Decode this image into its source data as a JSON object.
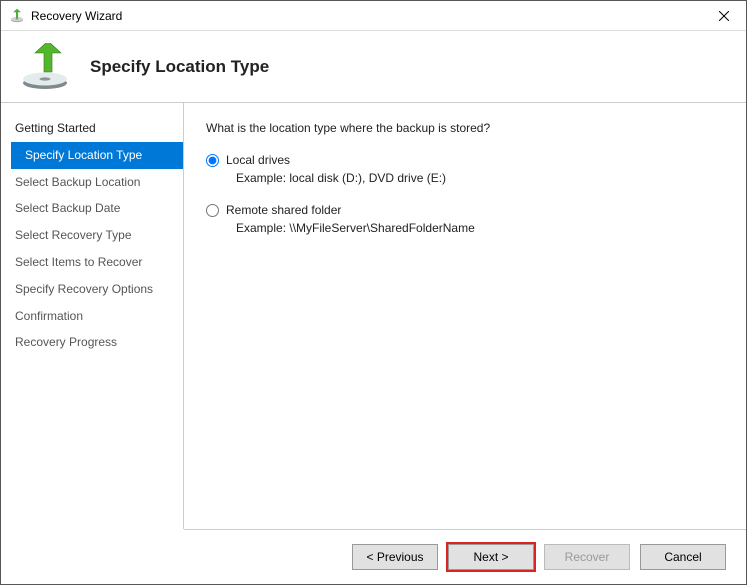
{
  "window": {
    "title": "Recovery Wizard"
  },
  "header": {
    "title": "Specify Location Type"
  },
  "sidebar": {
    "items": [
      {
        "label": "Getting Started"
      },
      {
        "label": "Specify Location Type"
      },
      {
        "label": "Select Backup Location"
      },
      {
        "label": "Select Backup Date"
      },
      {
        "label": "Select Recovery Type"
      },
      {
        "label": "Select Items to Recover"
      },
      {
        "label": "Specify Recovery Options"
      },
      {
        "label": "Confirmation"
      },
      {
        "label": "Recovery Progress"
      }
    ]
  },
  "content": {
    "prompt": "What is the location type where the backup is stored?",
    "options": [
      {
        "label": "Local drives",
        "example": "Example: local disk (D:), DVD drive (E:)",
        "checked": true
      },
      {
        "label": "Remote shared folder",
        "example": "Example: \\\\MyFileServer\\SharedFolderName",
        "checked": false
      }
    ]
  },
  "footer": {
    "previous": "< Previous",
    "next": "Next >",
    "recover": "Recover",
    "cancel": "Cancel"
  }
}
